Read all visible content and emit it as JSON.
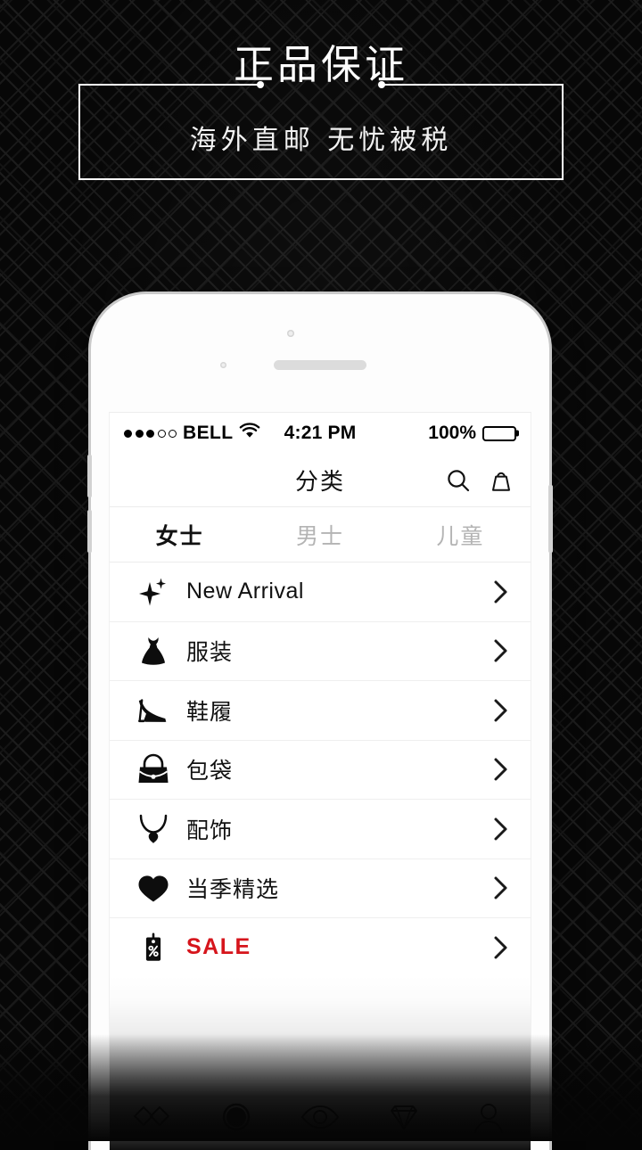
{
  "promo": {
    "title": "正品保证",
    "subtitle": "海外直邮 无忧被税"
  },
  "phone": {
    "status_bar": {
      "signal_dots_filled": 3,
      "signal_dots_empty": 2,
      "carrier": "BELL",
      "wifi_icon": "wifi-icon",
      "time": "4:21 PM",
      "battery_percent": "100%",
      "battery_icon": "battery-full-icon"
    },
    "nav_bar": {
      "title": "分类",
      "search_icon": "search-icon",
      "bag_icon": "shopping-bag-icon"
    },
    "tabs": [
      {
        "label": "女士",
        "active": true
      },
      {
        "label": "男士",
        "active": false
      },
      {
        "label": "儿童",
        "active": false
      }
    ],
    "categories": [
      {
        "label": "New Arrival",
        "icon": "sparkle-icon",
        "style": "latin",
        "chevron": "chevron-right-icon"
      },
      {
        "label": "服装",
        "icon": "dress-icon",
        "style": "cjk",
        "chevron": "chevron-right-icon"
      },
      {
        "label": "鞋履",
        "icon": "high-heel-icon",
        "style": "cjk",
        "chevron": "chevron-right-icon"
      },
      {
        "label": "包袋",
        "icon": "handbag-icon",
        "style": "cjk",
        "chevron": "chevron-right-icon"
      },
      {
        "label": "配饰",
        "icon": "necklace-icon",
        "style": "cjk",
        "chevron": "chevron-right-icon"
      },
      {
        "label": "当季精选",
        "icon": "heart-icon",
        "style": "cjk",
        "chevron": "chevron-right-icon"
      },
      {
        "label": "SALE",
        "icon": "price-tag-percent-icon",
        "style": "sale",
        "chevron": "chevron-right-icon"
      }
    ],
    "tab_bar": [
      {
        "icon": "diamonds-home-icon"
      },
      {
        "icon": "filled-circle-icon"
      },
      {
        "icon": "eye-icon"
      },
      {
        "icon": "gem-icon"
      },
      {
        "icon": "person-icon"
      }
    ]
  },
  "colors": {
    "background": "#070707",
    "promo_border": "#ffffff",
    "sale_red": "#d6151c",
    "active_text": "#111111",
    "inactive_text": "#b4b4b4",
    "device_body": "#fdfdfd"
  }
}
